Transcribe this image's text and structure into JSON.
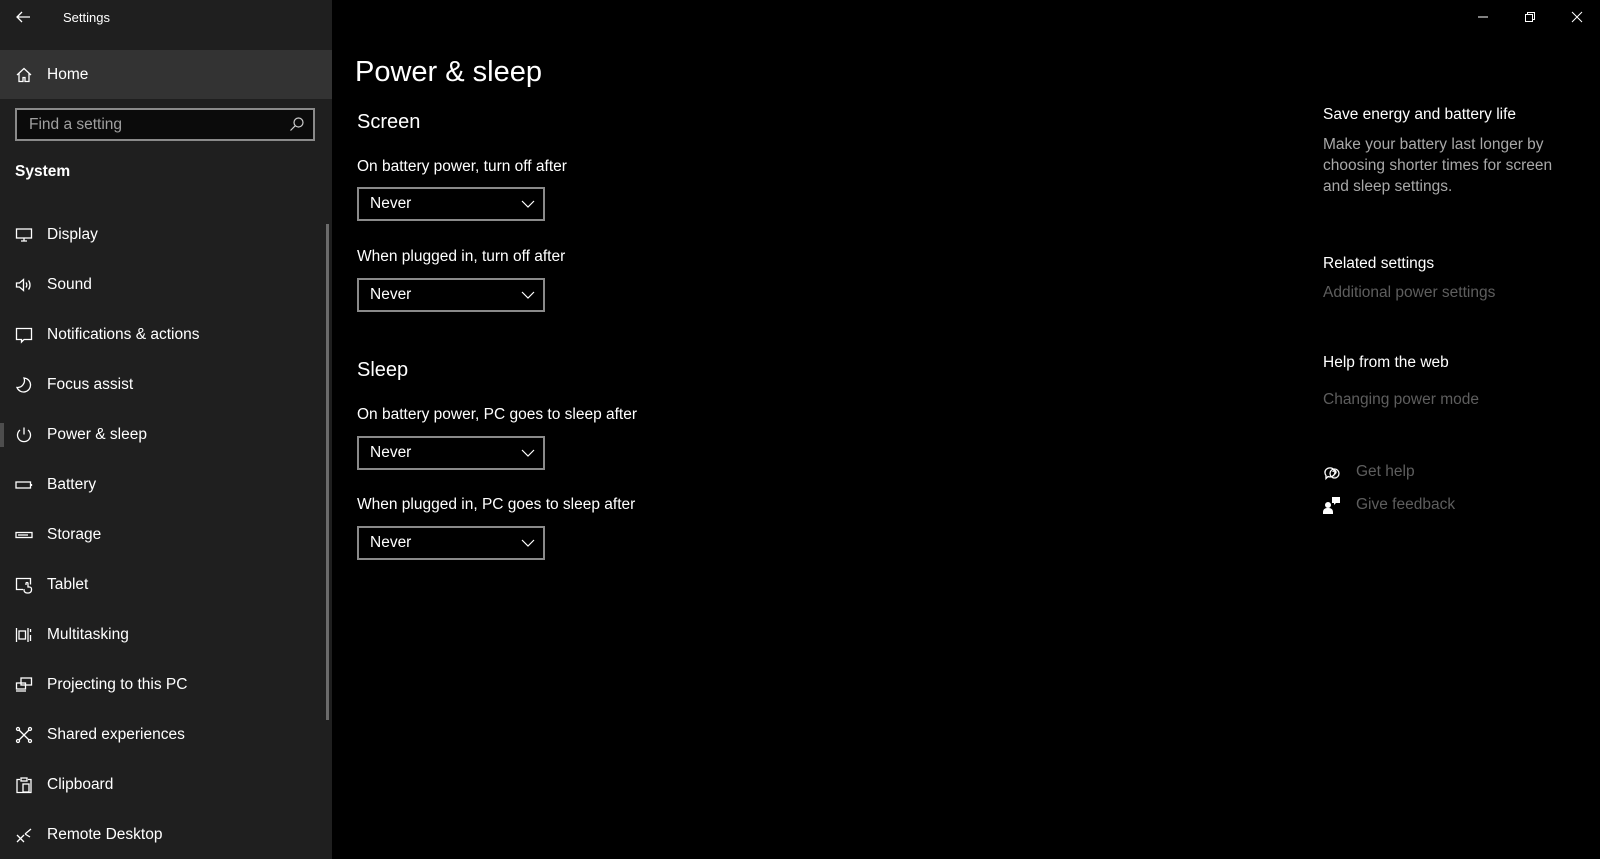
{
  "app": {
    "title": "Settings",
    "back_icon": "back-arrow-icon"
  },
  "window_controls": {
    "minimize": "minimize-icon",
    "restore": "restore-icon",
    "close": "close-icon"
  },
  "sidebar": {
    "home_label": "Home",
    "search_placeholder": "Find a setting",
    "search_value": "",
    "section_heading": "System",
    "items": [
      {
        "label": "Display",
        "icon": "display-icon",
        "selected": false
      },
      {
        "label": "Sound",
        "icon": "speaker-icon",
        "selected": false
      },
      {
        "label": "Notifications & actions",
        "icon": "notification-icon",
        "selected": false
      },
      {
        "label": "Focus assist",
        "icon": "moon-icon",
        "selected": false
      },
      {
        "label": "Power & sleep",
        "icon": "power-icon",
        "selected": true
      },
      {
        "label": "Battery",
        "icon": "battery-icon",
        "selected": false
      },
      {
        "label": "Storage",
        "icon": "storage-icon",
        "selected": false
      },
      {
        "label": "Tablet",
        "icon": "tablet-icon",
        "selected": false
      },
      {
        "label": "Multitasking",
        "icon": "multitasking-icon",
        "selected": false
      },
      {
        "label": "Projecting to this PC",
        "icon": "projecting-icon",
        "selected": false
      },
      {
        "label": "Shared experiences",
        "icon": "shared-experiences-icon",
        "selected": false
      },
      {
        "label": "Clipboard",
        "icon": "clipboard-icon",
        "selected": false
      },
      {
        "label": "Remote Desktop",
        "icon": "remote-desktop-icon",
        "selected": false
      }
    ]
  },
  "main": {
    "page_title": "Power & sleep",
    "screen": {
      "title": "Screen",
      "battery_label": "On battery power, turn off after",
      "battery_value": "Never",
      "plugged_label": "When plugged in, turn off after",
      "plugged_value": "Never"
    },
    "sleep": {
      "title": "Sleep",
      "battery_label": "On battery power, PC goes to sleep after",
      "battery_value": "Never",
      "plugged_label": "When plugged in, PC goes to sleep after",
      "plugged_value": "Never"
    }
  },
  "aside": {
    "save_energy_heading": "Save energy and battery life",
    "save_energy_text": "Make your battery last longer by choosing shorter times for screen and sleep settings.",
    "related_heading": "Related settings",
    "related_link": "Additional power settings",
    "help_heading": "Help from the web",
    "help_link": "Changing power mode",
    "get_help": "Get help",
    "give_feedback": "Give feedback"
  }
}
